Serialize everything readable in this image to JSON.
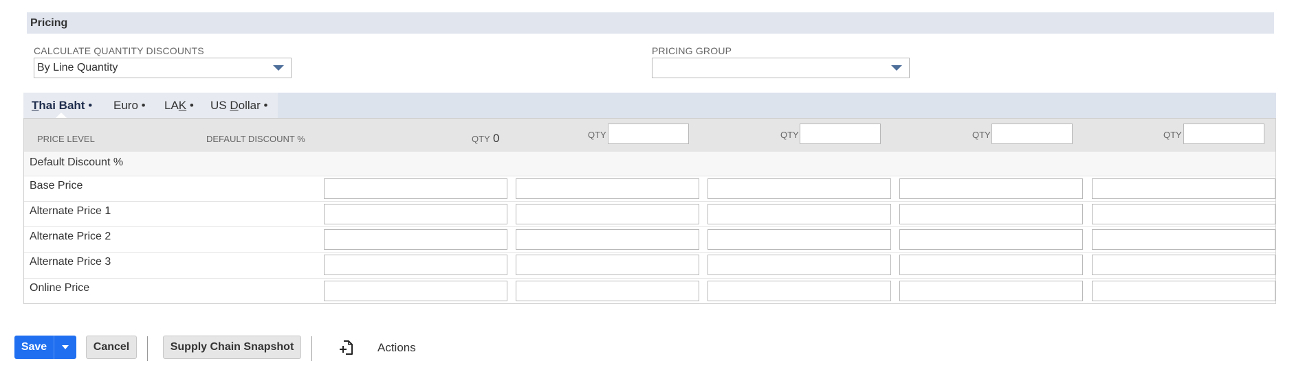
{
  "section": {
    "title": "Pricing"
  },
  "fields": {
    "calc_qty_discounts": {
      "label": "CALCULATE QUANTITY DISCOUNTS",
      "value": "By Line Quantity"
    },
    "pricing_group": {
      "label": "PRICING GROUP",
      "value": ""
    }
  },
  "tabs": [
    {
      "label": "Thai Baht",
      "suffix": "•",
      "active": true
    },
    {
      "label": "Euro",
      "suffix": "•",
      "active": false
    },
    {
      "label": "LAK",
      "suffix": "•",
      "active": false
    },
    {
      "label": "US Dollar",
      "suffix": "•",
      "active": false
    }
  ],
  "table": {
    "col_price_level": "PRICE LEVEL",
    "col_default_discount": "DEFAULT DISCOUNT %",
    "qty_label": "QTY",
    "qty0_value": "0",
    "rows": [
      "Default Discount %",
      "Base Price",
      "Alternate Price 1",
      "Alternate Price 2",
      "Alternate Price 3",
      "Online Price"
    ]
  },
  "footer": {
    "save": "Save",
    "cancel": "Cancel",
    "supply_chain": "Supply Chain Snapshot",
    "actions": "Actions"
  },
  "colors": {
    "accent": "#1f6ff0",
    "header_bg": "#e0e5ee",
    "tab_bg": "#dde3ed"
  }
}
